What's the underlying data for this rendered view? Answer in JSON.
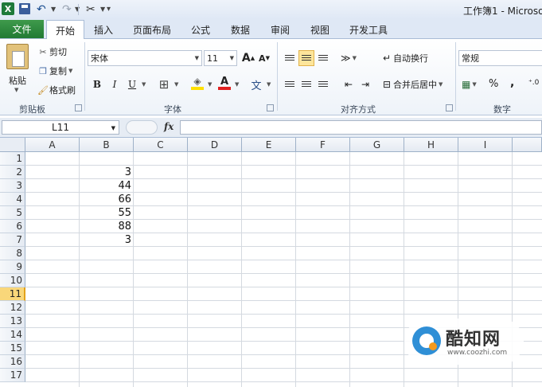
{
  "window": {
    "title": "工作簿1 - Microso"
  },
  "quick_access": {
    "excel_icon": "X",
    "undo_icon": "undo-icon",
    "redo_icon": "redo-icon"
  },
  "tabs": [
    {
      "label": "文件"
    },
    {
      "label": "开始",
      "active": true
    },
    {
      "label": "插入"
    },
    {
      "label": "页面布局"
    },
    {
      "label": "公式"
    },
    {
      "label": "数据"
    },
    {
      "label": "审阅"
    },
    {
      "label": "视图"
    },
    {
      "label": "开发工具"
    }
  ],
  "clipboard": {
    "group_label": "剪贴板",
    "paste": "粘贴",
    "cut": "剪切",
    "copy": "复制",
    "format_painter": "格式刷"
  },
  "font": {
    "group_label": "字体",
    "name": "宋体",
    "size": "11",
    "grow": "A",
    "shrink": "A",
    "bold": "B",
    "italic": "I",
    "underline": "U",
    "color_letter": "A",
    "phonetic": "文"
  },
  "alignment": {
    "group_label": "对齐方式",
    "wrap_text": "自动换行",
    "merge_center": "合并后居中"
  },
  "number": {
    "group_label": "数字",
    "format": "常规",
    "percent": "%",
    "comma": ","
  },
  "formula_bar": {
    "name_box": "L11",
    "fx": "fx",
    "formula": ""
  },
  "columns": [
    "A",
    "B",
    "C",
    "D",
    "E",
    "F",
    "G",
    "H",
    "I"
  ],
  "rows": [
    "1",
    "2",
    "3",
    "4",
    "5",
    "6",
    "7",
    "8",
    "9",
    "10",
    "11",
    "12",
    "13",
    "14",
    "15",
    "16",
    "17"
  ],
  "active_row": "11",
  "cells_B": [
    "",
    "3",
    "44",
    "66",
    "55",
    "88",
    "3"
  ],
  "watermark": {
    "name": "酷知网",
    "url": "www.coozhi.com"
  },
  "colors": {
    "file_tab": "#217a33",
    "active_row": "#f9d77a",
    "highlight": "#fde59b",
    "font_color": "#e02020",
    "fill_color": "#ffe000"
  }
}
